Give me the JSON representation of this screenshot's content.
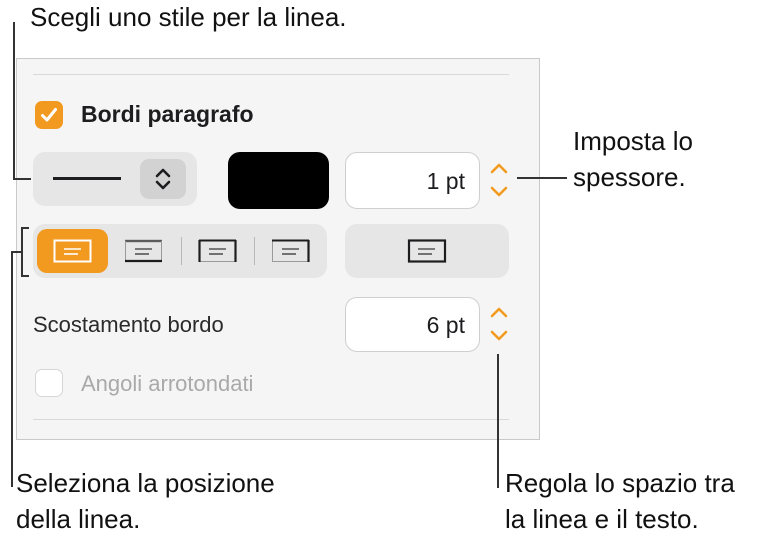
{
  "callouts": {
    "top": "Scegli uno stile per la linea.",
    "right_thickness_1": "Imposta lo",
    "right_thickness_2": "spessore.",
    "bottom_left_1": "Seleziona la posizione",
    "bottom_left_2": "della linea.",
    "bottom_right_1": "Regola lo spazio tra",
    "bottom_right_2": "la linea e il testo."
  },
  "panel": {
    "paragraph_borders": {
      "label": "Bordi paragrafo",
      "checked": true
    },
    "line_style": {
      "icon": "solid-line-icon",
      "popup_icon": "up-down-chevron-icon"
    },
    "color_well": {
      "color": "#000000"
    },
    "thickness": {
      "value": "1 pt"
    },
    "positions": [
      {
        "name": "border-all",
        "active": true
      },
      {
        "name": "border-top",
        "active": false
      },
      {
        "name": "border-sides",
        "active": false
      },
      {
        "name": "border-bottom",
        "active": false
      }
    ],
    "border_offset": {
      "label": "Scostamento bordo",
      "value": "6 pt"
    },
    "rounded_corners": {
      "label": "Angoli arrotondati",
      "checked": false,
      "enabled": false
    }
  },
  "colors": {
    "accent": "#f29a1f",
    "panel_bg": "#f5f5f5",
    "segment_bg": "#e6e6e6"
  }
}
